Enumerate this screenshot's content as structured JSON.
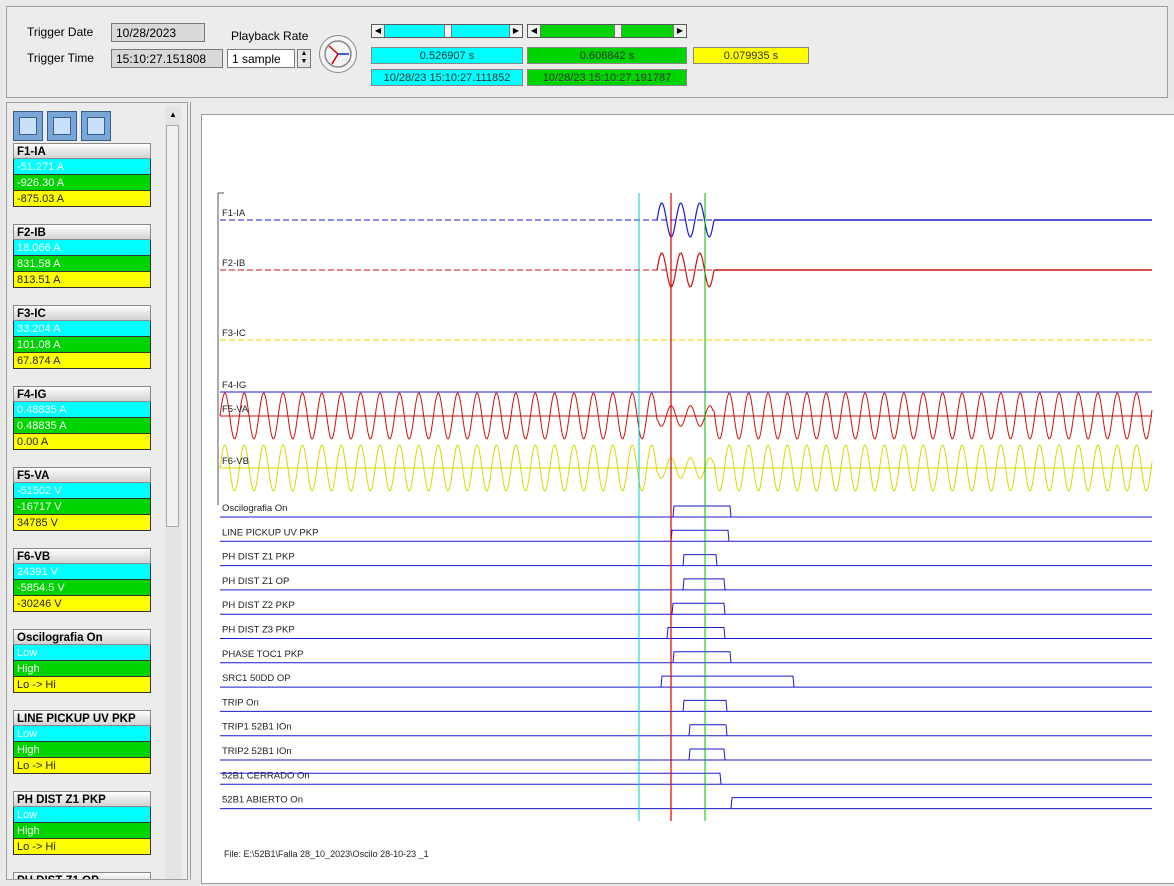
{
  "header": {
    "trigger_date_label": "Trigger Date",
    "trigger_date": "10/28/2023",
    "trigger_time_label": "Trigger Time",
    "trigger_time": "15:10:27.151808",
    "playback_rate_label": "Playback Rate",
    "playback_rate": "1 sample",
    "cursor1_time": "0.526907 s",
    "cursor2_time": "0.606842 s",
    "delta_time": "0.079935 s",
    "cursor1_timestamp": "10/28/23 15:10:27.111852",
    "cursor2_timestamp": "10/28/23 15:10:27.191787"
  },
  "colors": {
    "cursor1": "#00ffff",
    "cursor2": "#00d400",
    "delta": "#ffff00"
  },
  "sidebar": {
    "toolbar_icons": [
      "channel-x-icon",
      "channel-x2-icon",
      "layers-icon"
    ],
    "groups": [
      {
        "name": "F1-IA",
        "values": [
          "-51.271 A",
          "-926.30 A",
          "-875.03 A"
        ]
      },
      {
        "name": "F2-IB",
        "values": [
          "18.066 A",
          "831.58 A",
          "813.51 A"
        ]
      },
      {
        "name": "F3-IC",
        "values": [
          "33.204 A",
          "101.08 A",
          "67.874 A"
        ]
      },
      {
        "name": "F4-IG",
        "values": [
          "0.48835 A",
          "0.48835 A",
          "0.00 A"
        ]
      },
      {
        "name": "F5-VA",
        "values": [
          "-51502 V",
          "-16717 V",
          "34785 V"
        ]
      },
      {
        "name": "F6-VB",
        "values": [
          "24391 V",
          "-5854.5 V",
          "-30246 V"
        ]
      },
      {
        "name": "Oscilografia On",
        "values": [
          "Low",
          "High",
          "Lo -> Hi"
        ]
      },
      {
        "name": "LINE PICKUP UV PKP",
        "values": [
          "Low",
          "High",
          "Lo -> Hi"
        ]
      },
      {
        "name": "PH DIST Z1 PKP",
        "values": [
          "Low",
          "High",
          "Lo -> Hi"
        ]
      },
      {
        "name": "PH DIST Z1 OP",
        "values": []
      }
    ]
  },
  "plot": {
    "analog_channels": [
      "F1-IA",
      "F2-IB",
      "F3-IC",
      "F4-IG",
      "F5-VA",
      "F6-VB"
    ],
    "digital_channels": [
      "Oscilografia On",
      "LINE PICKUP UV PKP",
      "PH DIST Z1 PKP",
      "PH DIST Z1 OP",
      "PH DIST Z2 PKP",
      "PH DIST Z3 PKP",
      "PHASE TOC1 PKP",
      "SRC1 50DD OP",
      "TRIP     On",
      "TRIP1 52B1   IOn",
      "TRIP2 52B1   IOn",
      "52B1 CERRADO On",
      "52B1 ABIERTO On"
    ],
    "file_label": "File: E:\\52B1\\Falla 28_10_2023\\Oscilo 28-10-23 _1"
  }
}
